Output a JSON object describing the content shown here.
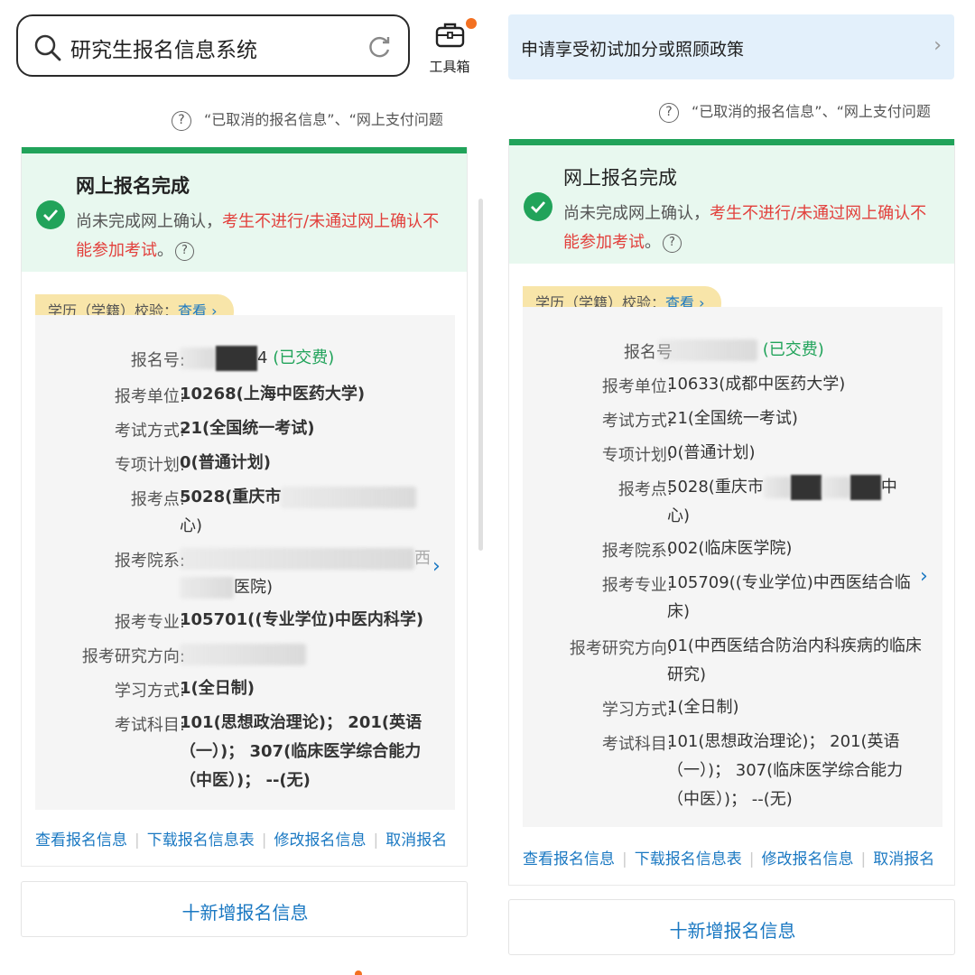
{
  "left": {
    "search": {
      "text": "研究生报名信息系统"
    },
    "toolbox": {
      "label": "工具箱"
    },
    "notice": "“已取消的报名信息”、“网上支付问题",
    "banner": {
      "title": "网上报名完成",
      "line_normal": "尚未完成网上确认，",
      "line_red": "考生不进行/未通过网上确认不能参加考试",
      "line_end": "。"
    },
    "tag": {
      "label": "学历（学籍）校验：",
      "link": "查看 ›"
    },
    "fields": {
      "reg_no": {
        "label": "报名号:",
        "value_suffix": "4",
        "status": "(已交费)"
      },
      "unit": {
        "label": "报考单位:",
        "value": "10268(上海中医药大学)"
      },
      "exam_mode": {
        "label": "考试方式:",
        "value": "21(全国统一考试)"
      },
      "plan": {
        "label": "专项计划:",
        "value": "0(普通计划)"
      },
      "site": {
        "label": "报考点:",
        "value_a": "5028(重庆市",
        "value_b": "心)"
      },
      "dept": {
        "label": "报考院系:",
        "value_a": "西",
        "value_b": "医院)"
      },
      "major": {
        "label": "报考专业:",
        "value": "105701((专业学位)中医内科学)"
      },
      "direction": {
        "label": "报考研究方向:"
      },
      "study": {
        "label": "学习方式:",
        "value": "1(全日制)"
      },
      "subjects": {
        "label": "考试科目:",
        "value": "101(思想政治理论)； 201(英语（一）)； 307(临床医学综合能力（中医）)； --(无)"
      }
    },
    "actions": [
      "查看报名信息",
      "下载报名信息表",
      "修改报名信息",
      "取消报名"
    ],
    "add": "十新增报名信息"
  },
  "right": {
    "policy": {
      "text": "申请享受初试加分或照顾政策",
      "chevron": "›"
    },
    "notice": "“已取消的报名信息”、“网上支付问题",
    "banner": {
      "title": "网上报名完成",
      "line_normal": "尚未完成网上确认，",
      "line_red": "考生不进行/未通过网上确认不能参加考试",
      "line_end": "。"
    },
    "tag": {
      "label": "学历（学籍）校验：",
      "link": "查看 ›"
    },
    "fields": {
      "reg_no": {
        "label": "报名号",
        "status": "(已交费)"
      },
      "unit": {
        "label": "报考单位:",
        "value": "10633(成都中医药大学)"
      },
      "exam_mode": {
        "label": "考试方式:",
        "value": "21(全国统一考试)"
      },
      "plan": {
        "label": "专项计划:",
        "value": "0(普通计划)"
      },
      "site": {
        "label": "报考点:",
        "value_a": "5028(重庆市",
        "value_b": "中",
        "value_c": "心)"
      },
      "dept": {
        "label": "报考院系:",
        "value": "002(临床医学院)"
      },
      "major": {
        "label": "报考专业:",
        "value": "105709((专业学位)中西医结合临床)"
      },
      "direction": {
        "label": "报考研究方向:",
        "value": "01(中西医结合防治内科疾病的临床研究)"
      },
      "study": {
        "label": "学习方式:",
        "value": "1(全日制)"
      },
      "subjects": {
        "label": "考试科目:",
        "value": "101(思想政治理论)； 201(英语（一）)； 307(临床医学综合能力（中医）)； --(无)"
      }
    },
    "actions": [
      "查看报名信息",
      "下载报名信息表",
      "修改报名信息",
      "取消报名"
    ],
    "add": "十新增报名信息"
  },
  "colors": {
    "green": "#21a35a",
    "red": "#e2403c",
    "link": "#1a78c2",
    "tag": "#f8e5a9",
    "badge": "#f37021"
  }
}
